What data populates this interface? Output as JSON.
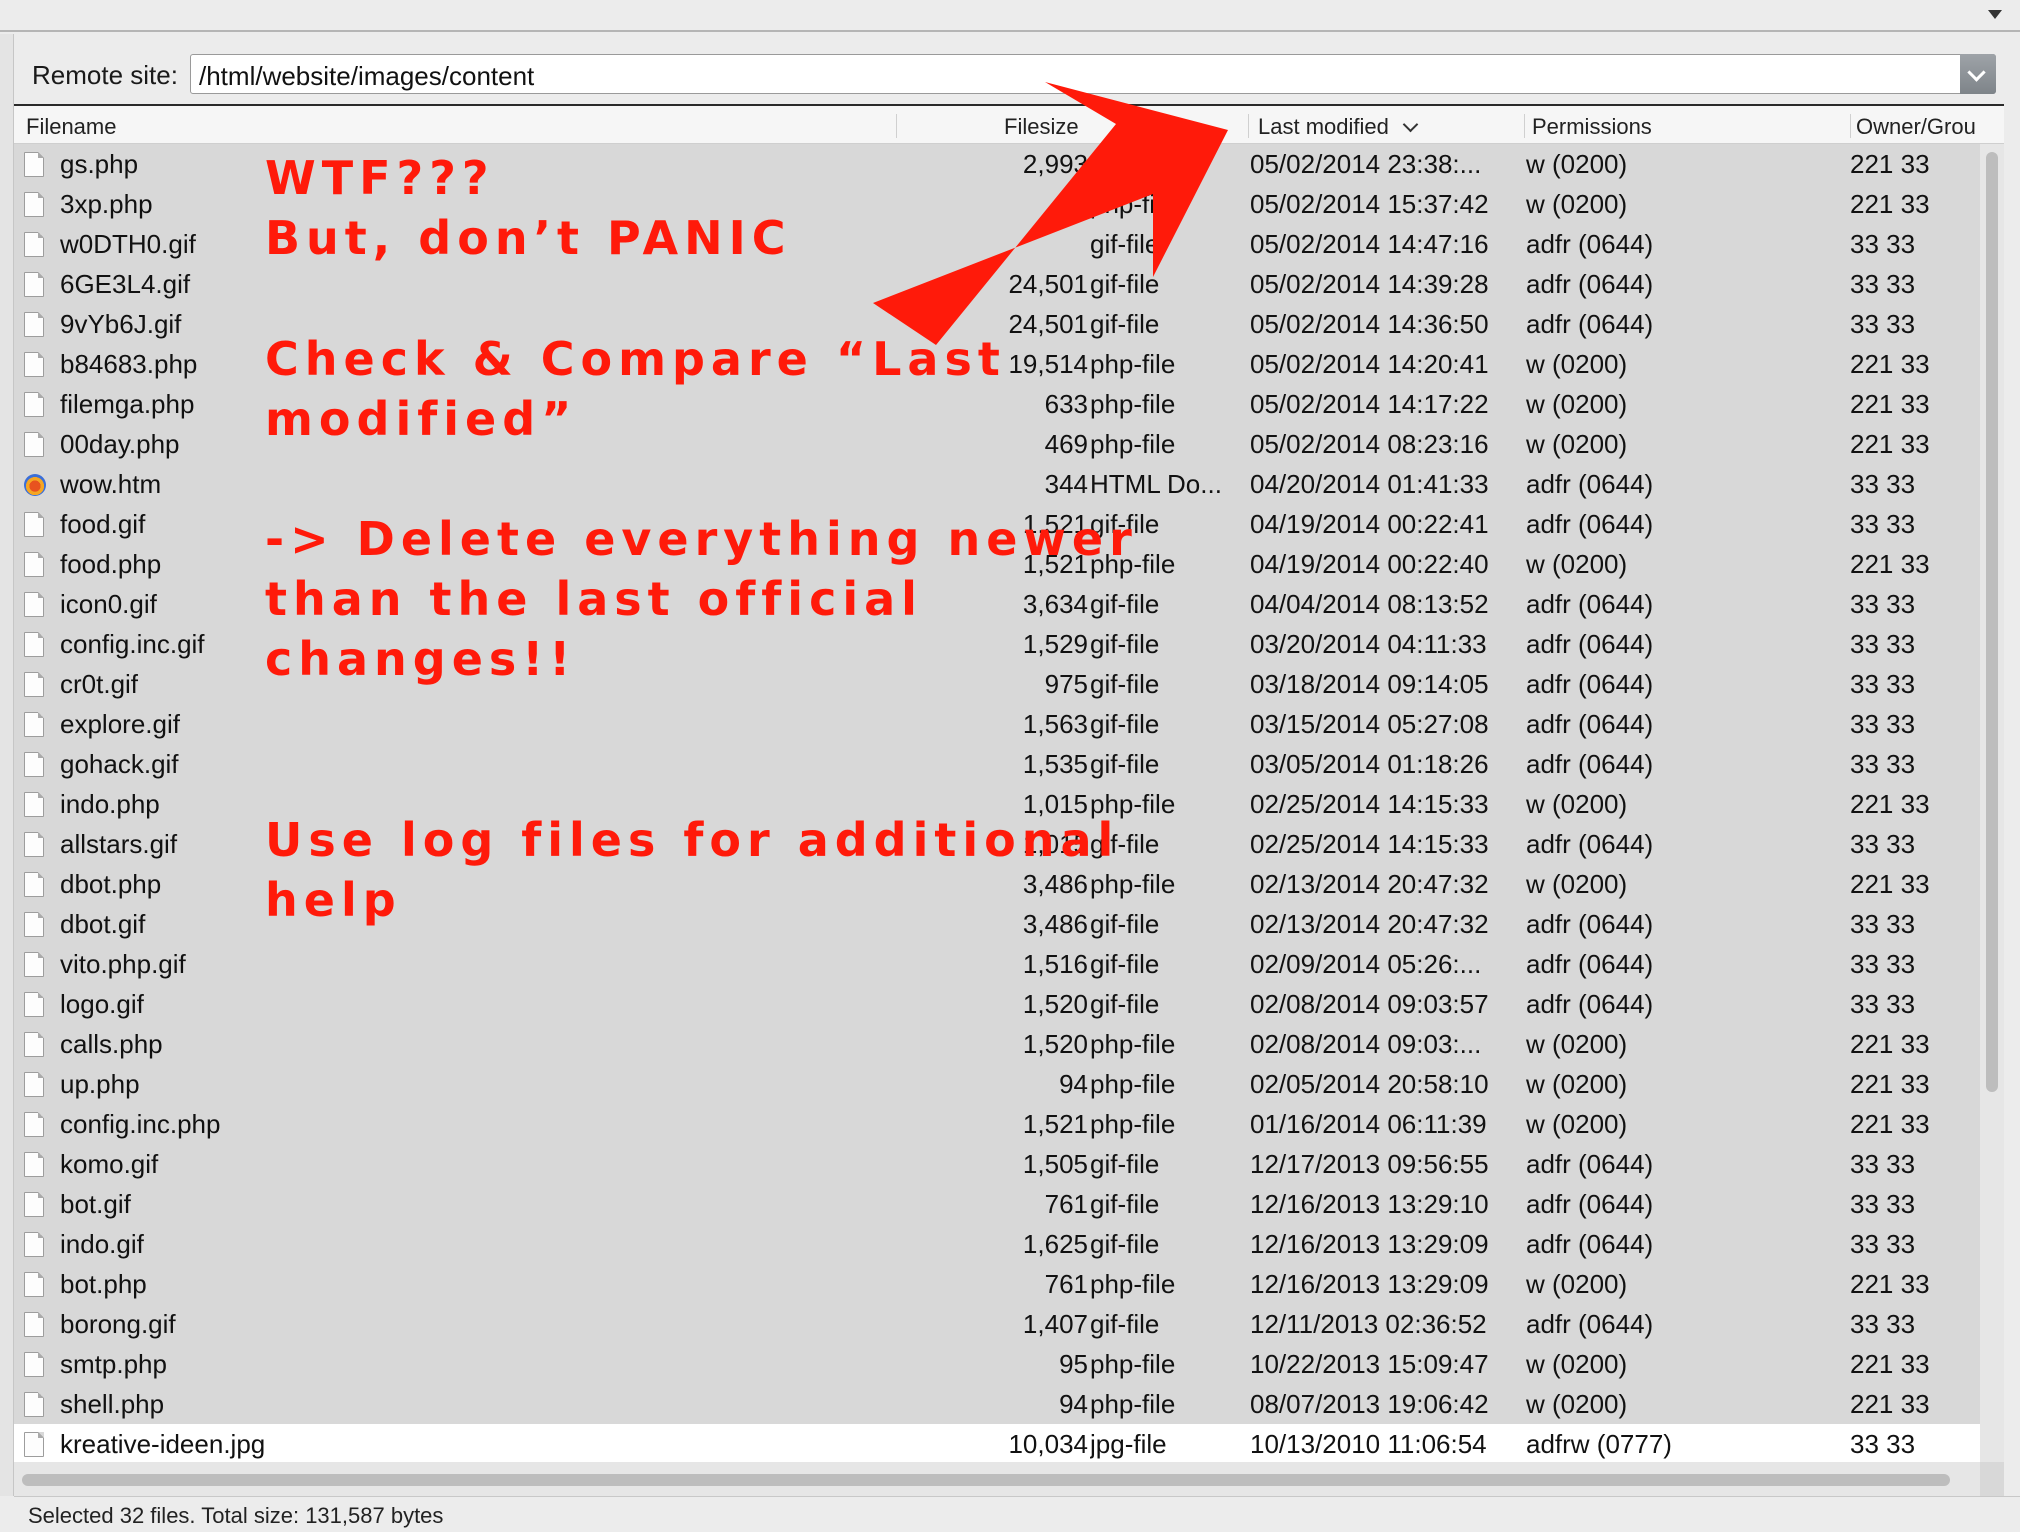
{
  "remote": {
    "label": "Remote site:",
    "path": "/html/website/images/content"
  },
  "columns": {
    "filename": "Filename",
    "filesize": "Filesize",
    "last_modified": "Last modified",
    "permissions": "Permissions",
    "owner_group": "Owner/Grou"
  },
  "files": [
    {
      "name": "gs.php",
      "size": "2,993",
      "type": "php-file",
      "modified": "05/02/2014 23:38:...",
      "perm": "w (0200)",
      "owner": "221 33",
      "icon": "file-icon"
    },
    {
      "name": "3xp.php",
      "size": "42",
      "type": "php-file",
      "modified": "05/02/2014 15:37:42",
      "perm": "w (0200)",
      "owner": "221 33",
      "icon": "file-icon"
    },
    {
      "name": "w0DTH0.gif",
      "size": "",
      "type": "gif-file",
      "modified": "05/02/2014 14:47:16",
      "perm": "adfr (0644)",
      "owner": "33 33",
      "icon": "file-icon"
    },
    {
      "name": "6GE3L4.gif",
      "size": "24,501",
      "type": "gif-file",
      "modified": "05/02/2014 14:39:28",
      "perm": "adfr (0644)",
      "owner": "33 33",
      "icon": "file-icon"
    },
    {
      "name": "9vYb6J.gif",
      "size": "24,501",
      "type": "gif-file",
      "modified": "05/02/2014 14:36:50",
      "perm": "adfr (0644)",
      "owner": "33 33",
      "icon": "file-icon"
    },
    {
      "name": "b84683.php",
      "size": "19,514",
      "type": "php-file",
      "modified": "05/02/2014 14:20:41",
      "perm": "w (0200)",
      "owner": "221 33",
      "icon": "file-icon"
    },
    {
      "name": "filemga.php",
      "size": "633",
      "type": "php-file",
      "modified": "05/02/2014 14:17:22",
      "perm": "w (0200)",
      "owner": "221 33",
      "icon": "file-icon"
    },
    {
      "name": "00day.php",
      "size": "469",
      "type": "php-file",
      "modified": "05/02/2014 08:23:16",
      "perm": "w (0200)",
      "owner": "221 33",
      "icon": "file-icon"
    },
    {
      "name": "wow.htm",
      "size": "344",
      "type": "HTML Do...",
      "modified": "04/20/2014 01:41:33",
      "perm": "adfr (0644)",
      "owner": "33 33",
      "icon": "html-icon"
    },
    {
      "name": "food.gif",
      "size": "1,521",
      "type": "gif-file",
      "modified": "04/19/2014 00:22:41",
      "perm": "adfr (0644)",
      "owner": "33 33",
      "icon": "file-icon"
    },
    {
      "name": "food.php",
      "size": "1,521",
      "type": "php-file",
      "modified": "04/19/2014 00:22:40",
      "perm": "w (0200)",
      "owner": "221 33",
      "icon": "file-icon"
    },
    {
      "name": "icon0.gif",
      "size": "3,634",
      "type": "gif-file",
      "modified": "04/04/2014 08:13:52",
      "perm": "adfr (0644)",
      "owner": "33 33",
      "icon": "file-icon"
    },
    {
      "name": "config.inc.gif",
      "size": "1,529",
      "type": "gif-file",
      "modified": "03/20/2014 04:11:33",
      "perm": "adfr (0644)",
      "owner": "33 33",
      "icon": "file-icon"
    },
    {
      "name": "cr0t.gif",
      "size": "975",
      "type": "gif-file",
      "modified": "03/18/2014 09:14:05",
      "perm": "adfr (0644)",
      "owner": "33 33",
      "icon": "file-icon"
    },
    {
      "name": "explore.gif",
      "size": "1,563",
      "type": "gif-file",
      "modified": "03/15/2014 05:27:08",
      "perm": "adfr (0644)",
      "owner": "33 33",
      "icon": "file-icon"
    },
    {
      "name": "gohack.gif",
      "size": "1,535",
      "type": "gif-file",
      "modified": "03/05/2014 01:18:26",
      "perm": "adfr (0644)",
      "owner": "33 33",
      "icon": "file-icon"
    },
    {
      "name": "indo.php",
      "size": "1,015",
      "type": "php-file",
      "modified": "02/25/2014 14:15:33",
      "perm": "w (0200)",
      "owner": "221 33",
      "icon": "file-icon"
    },
    {
      "name": "allstars.gif",
      "size": "1,015",
      "type": "gif-file",
      "modified": "02/25/2014 14:15:33",
      "perm": "adfr (0644)",
      "owner": "33 33",
      "icon": "file-icon"
    },
    {
      "name": "dbot.php",
      "size": "3,486",
      "type": "php-file",
      "modified": "02/13/2014 20:47:32",
      "perm": "w (0200)",
      "owner": "221 33",
      "icon": "file-icon"
    },
    {
      "name": "dbot.gif",
      "size": "3,486",
      "type": "gif-file",
      "modified": "02/13/2014 20:47:32",
      "perm": "adfr (0644)",
      "owner": "33 33",
      "icon": "file-icon"
    },
    {
      "name": "vito.php.gif",
      "size": "1,516",
      "type": "gif-file",
      "modified": "02/09/2014 05:26:...",
      "perm": "adfr (0644)",
      "owner": "33 33",
      "icon": "file-icon"
    },
    {
      "name": "logo.gif",
      "size": "1,520",
      "type": "gif-file",
      "modified": "02/08/2014 09:03:57",
      "perm": "adfr (0644)",
      "owner": "33 33",
      "icon": "file-icon"
    },
    {
      "name": "calls.php",
      "size": "1,520",
      "type": "php-file",
      "modified": "02/08/2014 09:03:...",
      "perm": "w (0200)",
      "owner": "221 33",
      "icon": "file-icon"
    },
    {
      "name": "up.php",
      "size": "94",
      "type": "php-file",
      "modified": "02/05/2014 20:58:10",
      "perm": "w (0200)",
      "owner": "221 33",
      "icon": "file-icon"
    },
    {
      "name": "config.inc.php",
      "size": "1,521",
      "type": "php-file",
      "modified": "01/16/2014 06:11:39",
      "perm": "w (0200)",
      "owner": "221 33",
      "icon": "file-icon"
    },
    {
      "name": "komo.gif",
      "size": "1,505",
      "type": "gif-file",
      "modified": "12/17/2013 09:56:55",
      "perm": "adfr (0644)",
      "owner": "33 33",
      "icon": "file-icon"
    },
    {
      "name": "bot.gif",
      "size": "761",
      "type": "gif-file",
      "modified": "12/16/2013 13:29:10",
      "perm": "adfr (0644)",
      "owner": "33 33",
      "icon": "file-icon"
    },
    {
      "name": "indo.gif",
      "size": "1,625",
      "type": "gif-file",
      "modified": "12/16/2013 13:29:09",
      "perm": "adfr (0644)",
      "owner": "33 33",
      "icon": "file-icon"
    },
    {
      "name": "bot.php",
      "size": "761",
      "type": "php-file",
      "modified": "12/16/2013 13:29:09",
      "perm": "w (0200)",
      "owner": "221 33",
      "icon": "file-icon"
    },
    {
      "name": "borong.gif",
      "size": "1,407",
      "type": "gif-file",
      "modified": "12/11/2013 02:36:52",
      "perm": "adfr (0644)",
      "owner": "33 33",
      "icon": "file-icon"
    },
    {
      "name": "smtp.php",
      "size": "95",
      "type": "php-file",
      "modified": "10/22/2013 15:09:47",
      "perm": "w (0200)",
      "owner": "221 33",
      "icon": "file-icon"
    },
    {
      "name": "shell.php",
      "size": "94",
      "type": "php-file",
      "modified": "08/07/2013 19:06:42",
      "perm": "w (0200)",
      "owner": "221 33",
      "icon": "file-icon"
    },
    {
      "name": "kreative-ideen.jpg",
      "size": "10,034",
      "type": "jpg-file",
      "modified": "10/13/2010 11:06:54",
      "perm": "adfrw (0777)",
      "owner": "33 33",
      "icon": "file-icon"
    }
  ],
  "status": "Selected 32 files. Total size: 131,587 bytes",
  "annotations": {
    "line1": "WTF???",
    "line2": "But, don’t PANIC",
    "line3": "Check & Compare “Last",
    "line4": "modified”",
    "line5": "-> Delete everything newer",
    "line6": "than the last official",
    "line7": "changes!!",
    "line8": "Use log files for additional",
    "line9": "help"
  },
  "colors": {
    "annotation": "#ff1a0a",
    "row_bg": "#d8d8d8",
    "row_selected_bg": "#ffffff"
  }
}
